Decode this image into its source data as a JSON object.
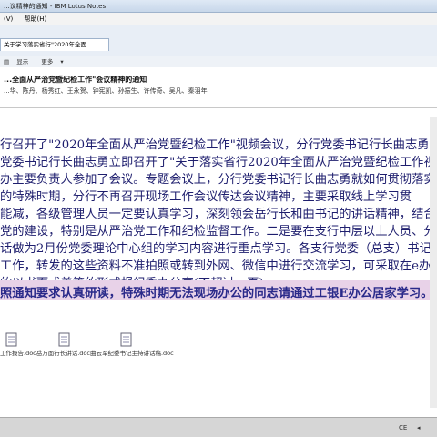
{
  "window": {
    "title": "...议精神的通知 - IBM Lotus Notes"
  },
  "menu": {
    "view": "(V)",
    "help": "帮助(H)"
  },
  "tab": {
    "label": "关于学习落实省行\"2020年全面..."
  },
  "toolbar": {
    "show": "显示",
    "more": "更多"
  },
  "doc": {
    "subject": "...全面从严治党暨纪检工作\"会议精神的通知",
    "recipients": "...华、陈丹、杨秀红、王永贺、钟宪凯、孙振生、许传奇、吴凡、秦羽年"
  },
  "body_lines": [
    "行召开了\"2020年全面从严治党暨纪检工作\"视频会议，分行党委书记行长曲志勇",
    "党委书记行长曲志勇立即召开了\"关于落实省行2020年全面从严治党暨纪检工作视",
    "办主要负责人参加了会议。专题会议上，分行党委书记行长曲志勇就如何贯彻落实",
    "的特殊时期，分行不再召开现场工作会议传达会议精神，主要采取线上学习贯",
    "能减，各级管理人员一定要认真学习，深刻领会岳行长和曲书记的讲话精神，结合",
    "党的建设，特别是从严治党工作和纪检监督工作。二是要在支行中层以上人员、分",
    "话做为2月份党委理论中心组的学习内容进行重点学习。各支行党委（总支）书记、",
    "工作，转发的这些资料不准拍照或转到外网、微信中进行交流学习，可采取在e办公",
    "的以书面或美篇的形式报纪委办公室(不超过一页)。"
  ],
  "emphasis": "照通知要求认真研读，特殊时期无法现场办公的同志请通过工银E办公居家学习。  请",
  "attachments_label": "工作报告.doc岳万面行长讲话.doc曲云军纪委书记主持讲话稿.doc",
  "status": {
    "ime": "CE"
  }
}
